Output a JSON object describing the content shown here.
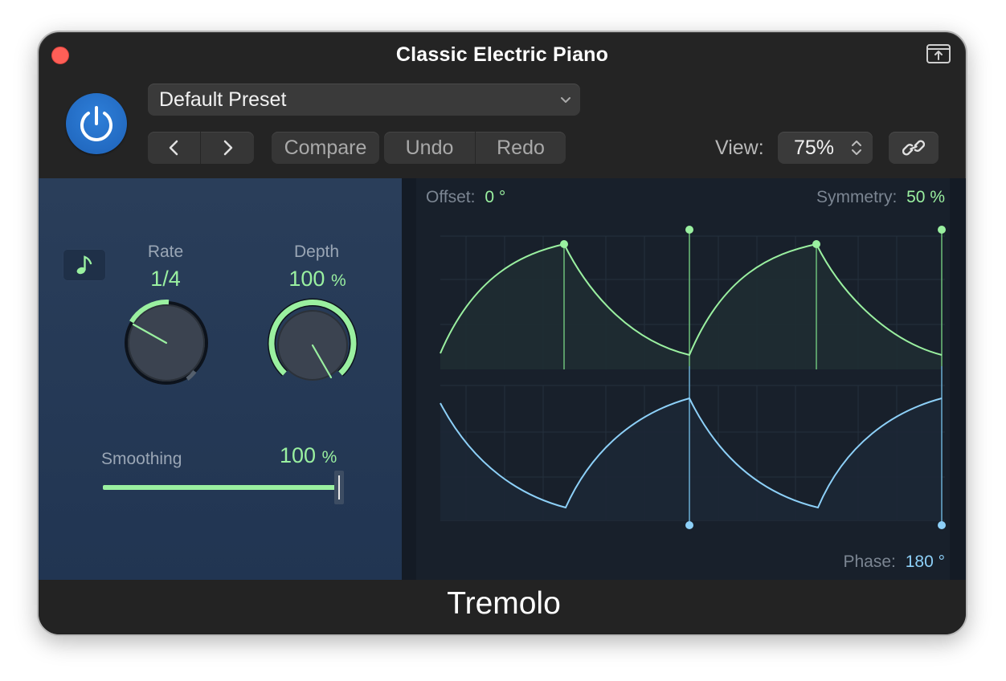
{
  "window": {
    "title": "Classic Electric Piano"
  },
  "header": {
    "preset": "Default Preset",
    "compare_label": "Compare",
    "undo_label": "Undo",
    "redo_label": "Redo",
    "view_label": "View:",
    "view_value": "75%"
  },
  "controls": {
    "rate_label": "Rate",
    "rate_value": "1/4",
    "depth_label": "Depth",
    "depth_value": "100",
    "depth_unit": "%",
    "smoothing_label": "Smoothing",
    "smoothing_value": "100",
    "smoothing_unit": "%",
    "smoothing_fraction": 1.0
  },
  "graph": {
    "offset_label": "Offset:",
    "offset_value": "0 °",
    "symmetry_label": "Symmetry:",
    "symmetry_value": "50 %",
    "phase_label": "Phase:",
    "phase_value": "180 °"
  },
  "footer": {
    "plugin_name": "Tremolo"
  },
  "colors": {
    "accent_green": "#9af0a0",
    "accent_blue": "#8dd0f8",
    "power_blue": "#2e7fd9",
    "close_red": "#fe5f57"
  },
  "icons": {
    "close": "close-icon",
    "float": "float-window-icon",
    "power": "power-icon",
    "chevron": "chevron-down-icon",
    "prev": "chevron-left-icon",
    "next": "chevron-right-icon",
    "stepper": "stepper-icon",
    "link": "link-icon",
    "note": "music-note-icon"
  }
}
